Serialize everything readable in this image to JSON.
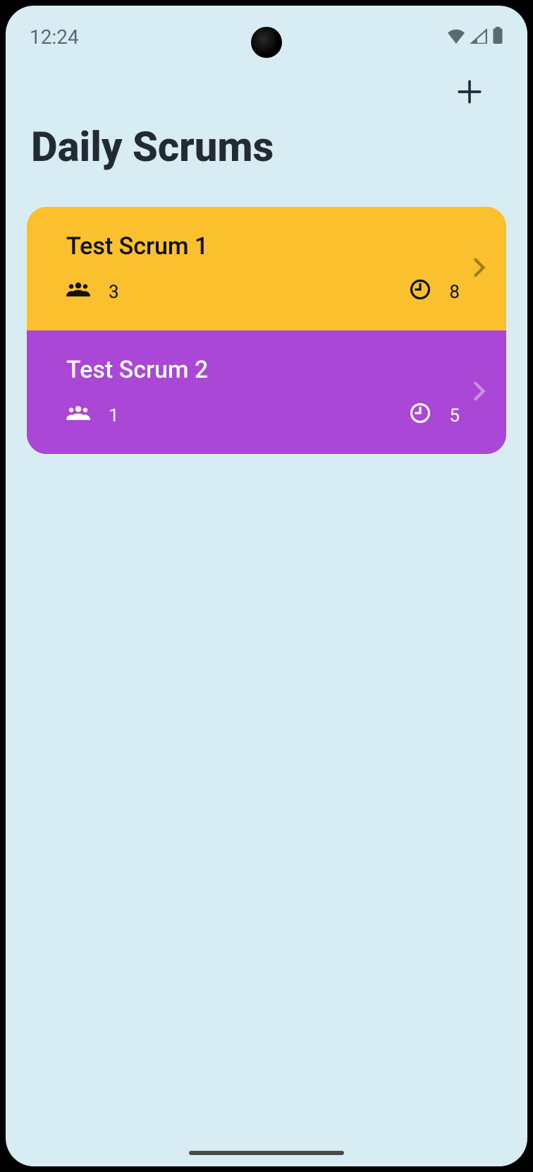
{
  "status_bar": {
    "time": "12:24"
  },
  "page_title": "Daily Scrums",
  "scrums": [
    {
      "title": "Test Scrum 1",
      "attendees": "3",
      "minutes": "8",
      "theme": "yellow"
    },
    {
      "title": "Test Scrum 2",
      "attendees": "1",
      "minutes": "5",
      "theme": "purple"
    }
  ]
}
